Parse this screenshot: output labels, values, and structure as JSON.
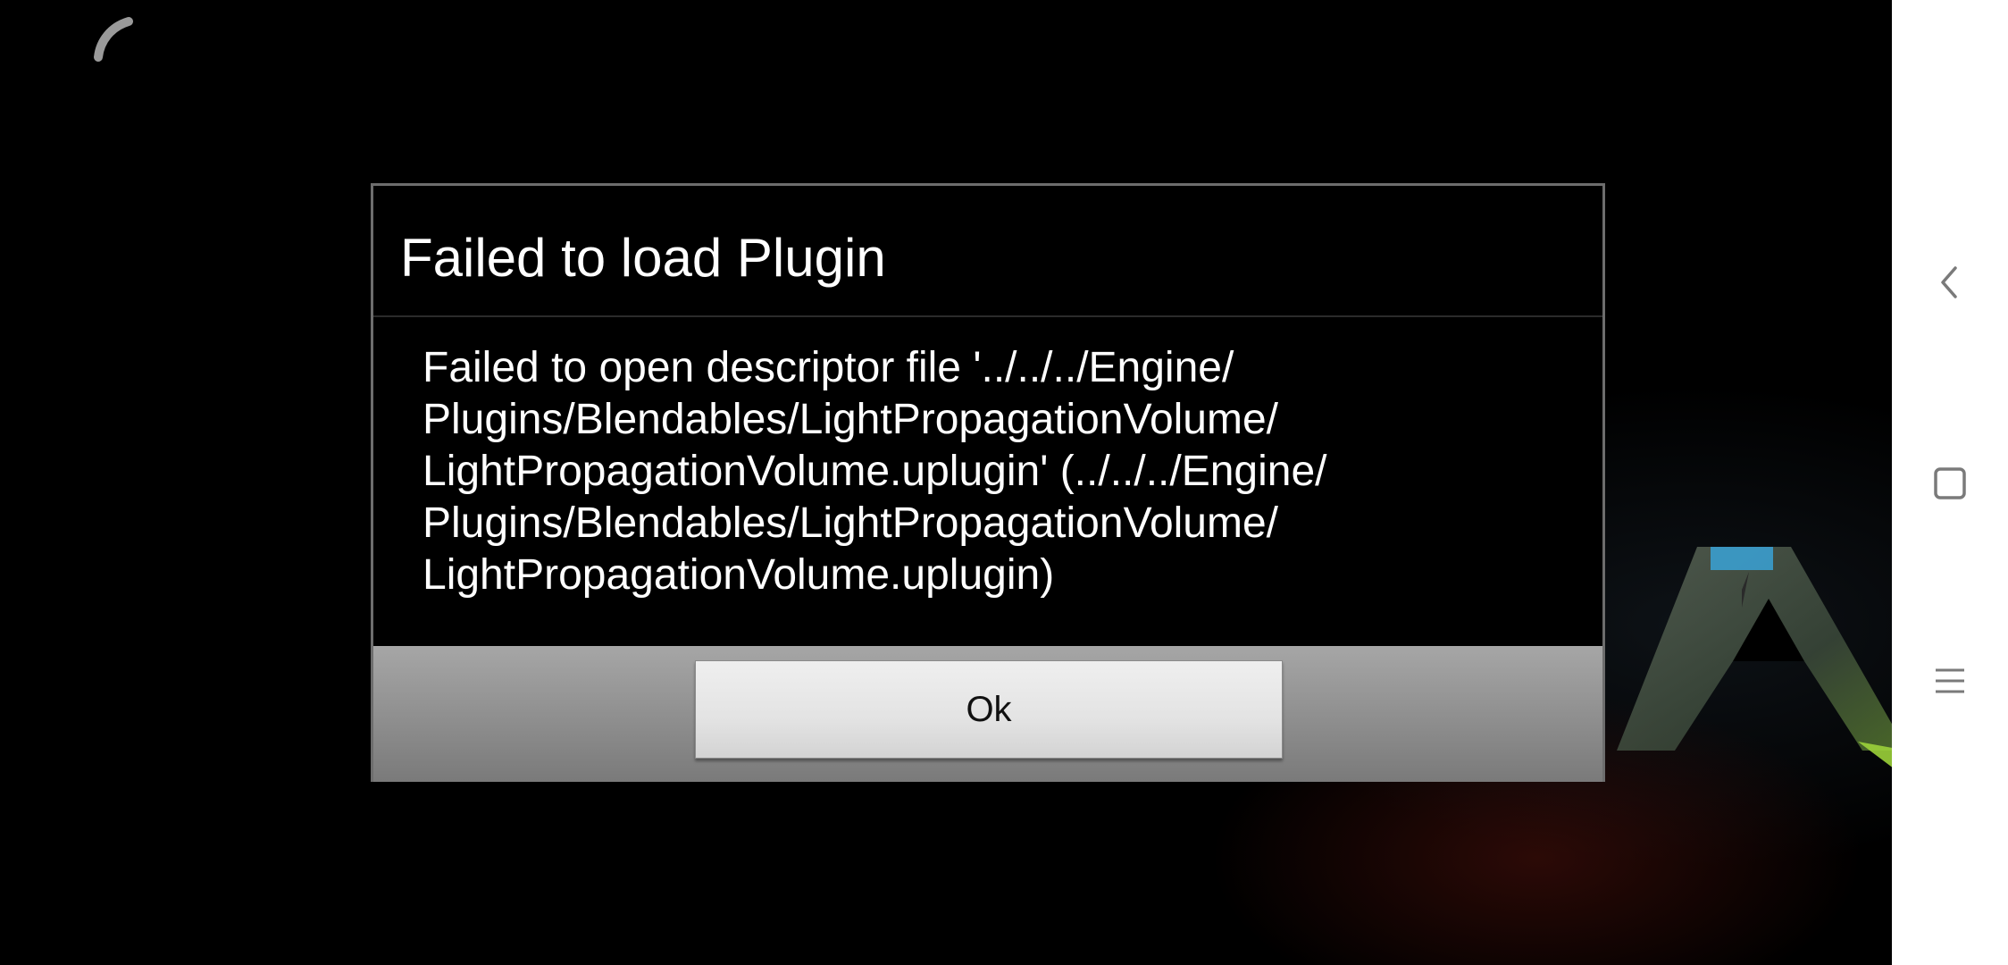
{
  "dialog": {
    "title": "Failed to load Plugin",
    "message_lines": [
      "Failed to open descriptor file '../../../Engine/",
      "Plugins/Blendables/LightPropagationVolume/",
      "LightPropagationVolume.uplugin' (../../../Engine/",
      "Plugins/Blendables/LightPropagationVolume/",
      "LightPropagationVolume.uplugin)"
    ],
    "ok_label": "Ok"
  },
  "navigation": {
    "items": [
      {
        "name": "back",
        "icon": "chevron-left-icon"
      },
      {
        "name": "home",
        "icon": "square-icon"
      },
      {
        "name": "recents",
        "icon": "menu-lines-icon"
      }
    ]
  },
  "icons": {
    "loading": "loading-spinner-icon",
    "logo": "ark-logo-icon"
  },
  "colors": {
    "dialog_background": "#000000",
    "dialog_text": "#ffffff",
    "button_bar": "#9a9a9a",
    "nav_bar": "#ffffff",
    "nav_icon": "#7a7a7a"
  }
}
